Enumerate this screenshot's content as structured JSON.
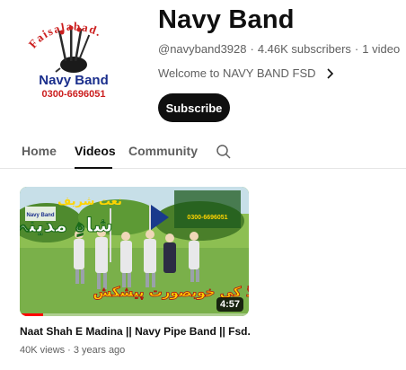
{
  "channel": {
    "avatar_top_text": "Faisalabad.",
    "avatar_brand": "Navy Band",
    "avatar_phone": "0300-6696051",
    "name": "Navy Band",
    "handle": "@navyband3928",
    "subscribers": "4.46K subscribers",
    "video_count": "1 video",
    "separator": "·",
    "about_text": "Welcome to NAVY BAND FSD",
    "subscribe_label": "Subscribe"
  },
  "tabs": [
    {
      "label": "Home",
      "active": false
    },
    {
      "label": "Videos",
      "active": true
    },
    {
      "label": "Community",
      "active": false
    }
  ],
  "video": {
    "title": "Naat Shah E Madina || Navy Pipe Band || Fsd.",
    "views": "40K views",
    "age": "3 years ago",
    "duration": "4:57",
    "watch_progress": 0.1,
    "thumb_overlay_brand": "Navy Band",
    "thumb_overlay_naat": "نعت شریف",
    "thumb_overlay_title": "شاہِ مدینہ",
    "thumb_overlay_phone": "0300-6696051",
    "thumb_overlay_bottom": "نیوی بینڈ کی خوبصورت پیشکش"
  },
  "colors": {
    "subscribe_bg": "#0f0f0f",
    "progress": "#ff0000",
    "secondary_text": "#606060",
    "avatar_red": "#cc1f1f",
    "avatar_blue": "#1a2e8c"
  },
  "icons": {
    "about_chevron": "chevron-right-icon",
    "tab_search": "search-icon"
  }
}
